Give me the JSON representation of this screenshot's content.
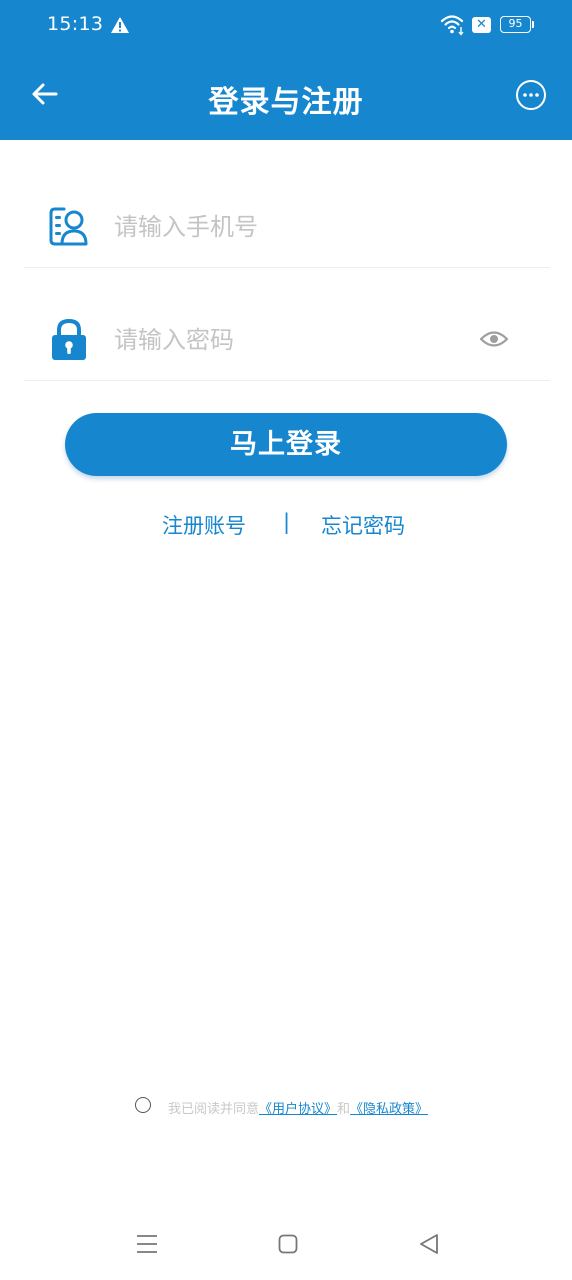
{
  "status_bar": {
    "time": "15:13",
    "battery": "95"
  },
  "header": {
    "title": "登录与注册"
  },
  "form": {
    "phone_placeholder": "请输入手机号",
    "password_placeholder": "请输入密码"
  },
  "login_button": "马上登录",
  "links": {
    "register": "注册账号",
    "separator": "|",
    "forgot": "忘记密码"
  },
  "agreement": {
    "prefix": "我已阅读并同意",
    "user_agreement": "《用户协议》",
    "and": "和",
    "privacy_policy": "《隐私政策》"
  },
  "colors": {
    "primary": "#1687cf",
    "placeholder": "#c4c4c4",
    "agreement_text": "#c8c8c8"
  },
  "icons": {
    "status": [
      "warning-icon",
      "wifi-icon",
      "notification-x-icon",
      "battery-icon"
    ],
    "header": [
      "back-arrow-icon",
      "more-options-icon"
    ],
    "form": [
      "phone-user-icon",
      "lock-icon",
      "eye-icon"
    ],
    "nav": [
      "menu-icon",
      "home-icon",
      "back-triangle-icon"
    ]
  }
}
